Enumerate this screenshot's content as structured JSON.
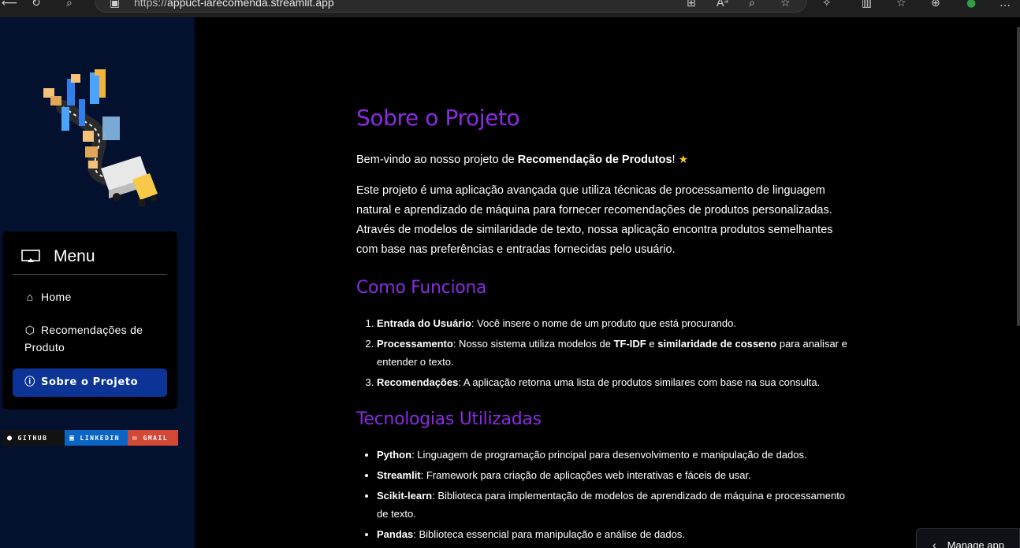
{
  "browser": {
    "url_prefix": "https://",
    "url_domain": "appuct-iarecomenda.streamlit.app",
    "icons": [
      "back-icon",
      "refresh-icon",
      "search-icon",
      "site-info-icon",
      "apps-icon",
      "read-aloud-icon",
      "zoom-icon",
      "favorite-icon",
      "extensions-icon",
      "split-screen-icon",
      "favorites-list-icon",
      "collections-icon",
      "profile-icon",
      "more-icon"
    ]
  },
  "sidebar": {
    "menu_title": "Menu",
    "items": [
      {
        "label": "Home",
        "icon": "house-icon",
        "active": false
      },
      {
        "label": "Recomendações de Produto",
        "icon": "box-icon",
        "active": false
      },
      {
        "label": "Sobre o Projeto",
        "icon": "info-icon",
        "active": true
      }
    ],
    "badges": [
      {
        "label": "GITHUB",
        "color": "#121212"
      },
      {
        "label": "LINKEDIN",
        "color": "#0a66c2"
      },
      {
        "label": "GMAIL",
        "color": "#d14836"
      }
    ]
  },
  "main": {
    "title": "Sobre o Projeto",
    "welcome_prefix": "Bem-vindo ao nosso projeto de ",
    "welcome_bold": "Recomendação de Produtos",
    "welcome_suffix": "!",
    "intro": "Este projeto é uma aplicação avançada que utiliza técnicas de processamento de linguagem natural e aprendizado de máquina para fornecer recomendações de produtos personalizadas. Através de modelos de similaridade de texto, nossa aplicação encontra produtos semelhantes com base nas preferências e entradas fornecidas pelo usuário.",
    "how_title": "Como Funciona",
    "steps": [
      {
        "bold": "Entrada do Usuário",
        "text": ": Você insere o nome de um produto que está procurando."
      },
      {
        "bold": "Processamento",
        "text": ": Nosso sistema utiliza modelos de ",
        "bold2": "TF-IDF",
        "mid": " e ",
        "bold3": "similaridade de cosseno",
        "end": " para analisar e entender o texto."
      },
      {
        "bold": "Recomendações",
        "text": ": A aplicação retorna uma lista de produtos similares com base na sua consulta."
      }
    ],
    "tech_title": "Tecnologias Utilizadas",
    "techs": [
      {
        "bold": "Python",
        "text": ": Linguagem de programação principal para desenvolvimento e manipulação de dados."
      },
      {
        "bold": "Streamlit",
        "text": ": Framework para criação de aplicações web interativas e fáceis de usar."
      },
      {
        "bold": "Scikit-learn",
        "text": ": Biblioteca para implementação de modelos de aprendizado de máquina e processamento de texto."
      },
      {
        "bold": "Pandas",
        "text": ": Biblioteca essencial para manipulação e análise de dados."
      }
    ]
  },
  "manage_app": "Manage app",
  "colors": {
    "accent": "#8a2be2",
    "sidebar_bg": "#04112e",
    "active_item": "#0b3496"
  }
}
